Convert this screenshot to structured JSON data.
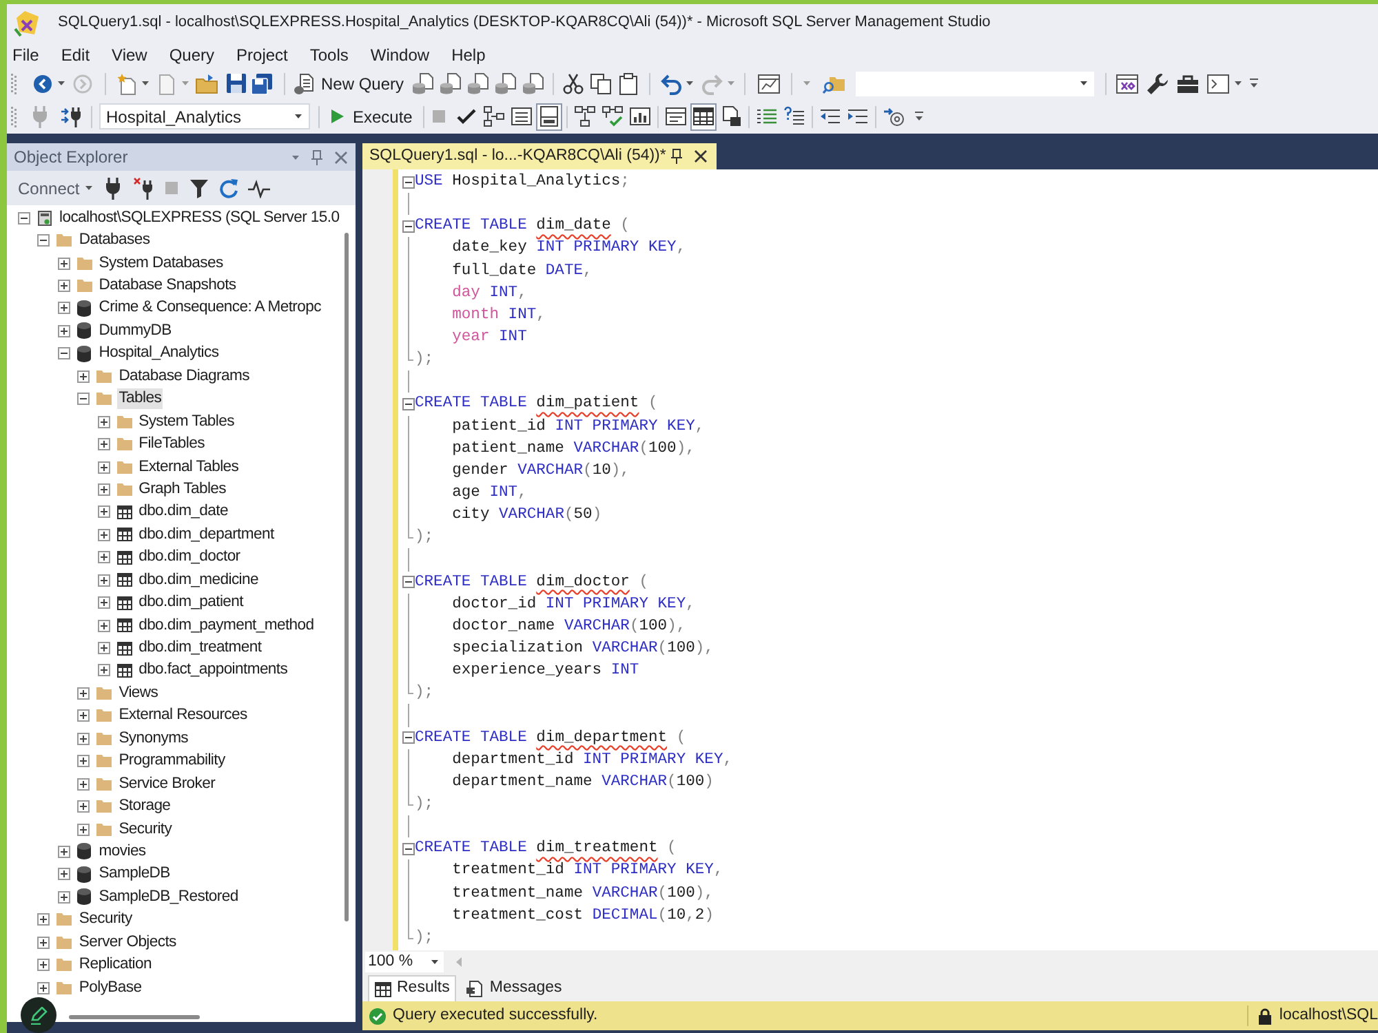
{
  "window": {
    "title": "SQLQuery1.sql - localhost\\SQLEXPRESS.Hospital_Analytics (DESKTOP-KQAR8CQ\\Ali (54))* - Microsoft SQL Server Management Studio"
  },
  "menu": [
    "File",
    "Edit",
    "View",
    "Query",
    "Project",
    "Tools",
    "Window",
    "Help"
  ],
  "standard_toolbar": {
    "new_query": "New Query"
  },
  "query_toolbar": {
    "database": "Hospital_Analytics",
    "execute": "Execute",
    "buttons": [
      {
        "selected": false
      },
      {
        "selected": false
      },
      {
        "selected": false
      },
      {
        "selected": false
      },
      {
        "selected": true
      },
      {
        "selected": false
      },
      {
        "selected": false
      },
      {
        "selected": false
      },
      {
        "selected": false
      },
      {
        "selected": true
      },
      {
        "selected": false
      },
      {
        "selected": false
      },
      {
        "selected": false
      },
      {
        "selected": false
      },
      {
        "selected": false
      },
      {
        "selected": false
      }
    ]
  },
  "object_explorer": {
    "title": "Object Explorer",
    "connect": "Connect",
    "tree": [
      {
        "label": "localhost\\SQLEXPRESS (SQL Server 15.0",
        "kind": "server",
        "expanded": true,
        "selected": false,
        "children": [
          {
            "label": "Databases",
            "kind": "folder",
            "expanded": true,
            "selected": false,
            "children": [
              {
                "label": "System Databases",
                "kind": "folder",
                "expanded": false,
                "selected": false
              },
              {
                "label": "Database Snapshots",
                "kind": "folder",
                "expanded": false,
                "selected": false
              },
              {
                "label": "Crime & Consequence: A Metropc",
                "kind": "database",
                "expanded": false,
                "selected": false
              },
              {
                "label": "DummyDB",
                "kind": "database",
                "expanded": false,
                "selected": false
              },
              {
                "label": "Hospital_Analytics",
                "kind": "database",
                "expanded": true,
                "selected": false,
                "children": [
                  {
                    "label": "Database Diagrams",
                    "kind": "folder",
                    "expanded": false,
                    "selected": false
                  },
                  {
                    "label": "Tables",
                    "kind": "folder",
                    "expanded": true,
                    "selected": true,
                    "children": [
                      {
                        "label": "System Tables",
                        "kind": "folder",
                        "expanded": false,
                        "selected": false
                      },
                      {
                        "label": "FileTables",
                        "kind": "folder",
                        "expanded": false,
                        "selected": false
                      },
                      {
                        "label": "External Tables",
                        "kind": "folder",
                        "expanded": false,
                        "selected": false
                      },
                      {
                        "label": "Graph Tables",
                        "kind": "folder",
                        "expanded": false,
                        "selected": false
                      },
                      {
                        "label": "dbo.dim_date",
                        "kind": "table",
                        "expanded": false,
                        "selected": false
                      },
                      {
                        "label": "dbo.dim_department",
                        "kind": "table",
                        "expanded": false,
                        "selected": false
                      },
                      {
                        "label": "dbo.dim_doctor",
                        "kind": "table",
                        "expanded": false,
                        "selected": false
                      },
                      {
                        "label": "dbo.dim_medicine",
                        "kind": "table",
                        "expanded": false,
                        "selected": false
                      },
                      {
                        "label": "dbo.dim_patient",
                        "kind": "table",
                        "expanded": false,
                        "selected": false
                      },
                      {
                        "label": "dbo.dim_payment_method",
                        "kind": "table",
                        "expanded": false,
                        "selected": false
                      },
                      {
                        "label": "dbo.dim_treatment",
                        "kind": "table",
                        "expanded": false,
                        "selected": false
                      },
                      {
                        "label": "dbo.fact_appointments",
                        "kind": "table",
                        "expanded": false,
                        "selected": false
                      }
                    ]
                  },
                  {
                    "label": "Views",
                    "kind": "folder",
                    "expanded": false,
                    "selected": false
                  },
                  {
                    "label": "External Resources",
                    "kind": "folder",
                    "expanded": false,
                    "selected": false
                  },
                  {
                    "label": "Synonyms",
                    "kind": "folder",
                    "expanded": false,
                    "selected": false
                  },
                  {
                    "label": "Programmability",
                    "kind": "folder",
                    "expanded": false,
                    "selected": false
                  },
                  {
                    "label": "Service Broker",
                    "kind": "folder",
                    "expanded": false,
                    "selected": false
                  },
                  {
                    "label": "Storage",
                    "kind": "folder",
                    "expanded": false,
                    "selected": false
                  },
                  {
                    "label": "Security",
                    "kind": "folder",
                    "expanded": false,
                    "selected": false
                  }
                ]
              },
              {
                "label": "movies",
                "kind": "database",
                "expanded": false,
                "selected": false
              },
              {
                "label": "SampleDB",
                "kind": "database",
                "expanded": false,
                "selected": false
              },
              {
                "label": "SampleDB_Restored",
                "kind": "database",
                "expanded": false,
                "selected": false
              }
            ]
          },
          {
            "label": "Security",
            "kind": "folder",
            "expanded": false,
            "selected": false
          },
          {
            "label": "Server Objects",
            "kind": "folder",
            "expanded": false,
            "selected": false
          },
          {
            "label": "Replication",
            "kind": "folder",
            "expanded": false,
            "selected": false
          },
          {
            "label": "PolyBase",
            "kind": "folder",
            "expanded": false,
            "selected": false
          }
        ]
      }
    ]
  },
  "editor": {
    "tab_title": "SQLQuery1.sql - lo...-KQAR8CQ\\Ali (54))*",
    "statements": [
      {
        "lines": [
          {
            "tokens": [
              {
                "text": "USE",
                "kind": "keyword"
              },
              {
                "text": " Hospital_Analytics",
                "kind": "plain"
              },
              {
                "text": ";",
                "kind": "punct"
              }
            ]
          }
        ]
      },
      {
        "lines": [
          {
            "tokens": [
              {
                "text": "CREATE TABLE ",
                "kind": "keyword"
              },
              {
                "text": "dim_date",
                "kind": "flagged"
              },
              {
                "text": " (",
                "kind": "punct"
              }
            ],
            "children": [
              {
                "tokens": [
                  {
                    "text": "date_key ",
                    "kind": "plain"
                  },
                  {
                    "text": "INT PRIMARY KEY",
                    "kind": "keyword"
                  },
                  {
                    "text": ",",
                    "kind": "punct"
                  }
                ]
              },
              {
                "tokens": [
                  {
                    "text": "full_date ",
                    "kind": "plain"
                  },
                  {
                    "text": "DATE",
                    "kind": "keyword"
                  },
                  {
                    "text": ",",
                    "kind": "punct"
                  }
                ]
              },
              {
                "tokens": [
                  {
                    "text": "day",
                    "kind": "builtin"
                  },
                  {
                    "text": " INT",
                    "kind": "keyword"
                  },
                  {
                    "text": ",",
                    "kind": "punct"
                  }
                ]
              },
              {
                "tokens": [
                  {
                    "text": "month",
                    "kind": "builtin"
                  },
                  {
                    "text": " INT",
                    "kind": "keyword"
                  },
                  {
                    "text": ",",
                    "kind": "punct"
                  }
                ]
              },
              {
                "tokens": [
                  {
                    "text": "year",
                    "kind": "builtin"
                  },
                  {
                    "text": " INT",
                    "kind": "keyword"
                  }
                ]
              }
            ]
          },
          {
            "tokens": [
              {
                "text": ");",
                "kind": "punct"
              }
            ]
          }
        ]
      },
      {
        "lines": [
          {
            "tokens": [
              {
                "text": "CREATE TABLE ",
                "kind": "keyword"
              },
              {
                "text": "dim_patient",
                "kind": "flagged"
              },
              {
                "text": " (",
                "kind": "punct"
              }
            ],
            "children": [
              {
                "tokens": [
                  {
                    "text": "patient_id ",
                    "kind": "plain"
                  },
                  {
                    "text": "INT PRIMARY KEY",
                    "kind": "keyword"
                  },
                  {
                    "text": ",",
                    "kind": "punct"
                  }
                ]
              },
              {
                "tokens": [
                  {
                    "text": "patient_name ",
                    "kind": "plain"
                  },
                  {
                    "text": "VARCHAR",
                    "kind": "keyword"
                  },
                  {
                    "text": "(",
                    "kind": "punct"
                  },
                  {
                    "text": "100",
                    "kind": "plain"
                  },
                  {
                    "text": "),",
                    "kind": "punct"
                  }
                ]
              },
              {
                "tokens": [
                  {
                    "text": "gender ",
                    "kind": "plain"
                  },
                  {
                    "text": "VARCHAR",
                    "kind": "keyword"
                  },
                  {
                    "text": "(",
                    "kind": "punct"
                  },
                  {
                    "text": "10",
                    "kind": "plain"
                  },
                  {
                    "text": "),",
                    "kind": "punct"
                  }
                ]
              },
              {
                "tokens": [
                  {
                    "text": "age ",
                    "kind": "plain"
                  },
                  {
                    "text": "INT",
                    "kind": "keyword"
                  },
                  {
                    "text": ",",
                    "kind": "punct"
                  }
                ]
              },
              {
                "tokens": [
                  {
                    "text": "city ",
                    "kind": "plain"
                  },
                  {
                    "text": "VARCHAR",
                    "kind": "keyword"
                  },
                  {
                    "text": "(",
                    "kind": "punct"
                  },
                  {
                    "text": "50",
                    "kind": "plain"
                  },
                  {
                    "text": ")",
                    "kind": "punct"
                  }
                ]
              }
            ]
          },
          {
            "tokens": [
              {
                "text": ");",
                "kind": "punct"
              }
            ]
          }
        ]
      },
      {
        "lines": [
          {
            "tokens": [
              {
                "text": "CREATE TABLE ",
                "kind": "keyword"
              },
              {
                "text": "dim_doctor",
                "kind": "flagged"
              },
              {
                "text": " (",
                "kind": "punct"
              }
            ],
            "children": [
              {
                "tokens": [
                  {
                    "text": "doctor_id ",
                    "kind": "plain"
                  },
                  {
                    "text": "INT PRIMARY KEY",
                    "kind": "keyword"
                  },
                  {
                    "text": ",",
                    "kind": "punct"
                  }
                ]
              },
              {
                "tokens": [
                  {
                    "text": "doctor_name ",
                    "kind": "plain"
                  },
                  {
                    "text": "VARCHAR",
                    "kind": "keyword"
                  },
                  {
                    "text": "(",
                    "kind": "punct"
                  },
                  {
                    "text": "100",
                    "kind": "plain"
                  },
                  {
                    "text": "),",
                    "kind": "punct"
                  }
                ]
              },
              {
                "tokens": [
                  {
                    "text": "specialization ",
                    "kind": "plain"
                  },
                  {
                    "text": "VARCHAR",
                    "kind": "keyword"
                  },
                  {
                    "text": "(",
                    "kind": "punct"
                  },
                  {
                    "text": "100",
                    "kind": "plain"
                  },
                  {
                    "text": "),",
                    "kind": "punct"
                  }
                ]
              },
              {
                "tokens": [
                  {
                    "text": "experience_years ",
                    "kind": "plain"
                  },
                  {
                    "text": "INT",
                    "kind": "keyword"
                  }
                ]
              }
            ]
          },
          {
            "tokens": [
              {
                "text": ");",
                "kind": "punct"
              }
            ]
          }
        ]
      },
      {
        "lines": [
          {
            "tokens": [
              {
                "text": "CREATE TABLE ",
                "kind": "keyword"
              },
              {
                "text": "dim_department",
                "kind": "flagged"
              },
              {
                "text": " (",
                "kind": "punct"
              }
            ],
            "children": [
              {
                "tokens": [
                  {
                    "text": "department_id ",
                    "kind": "plain"
                  },
                  {
                    "text": "INT PRIMARY KEY",
                    "kind": "keyword"
                  },
                  {
                    "text": ",",
                    "kind": "punct"
                  }
                ]
              },
              {
                "tokens": [
                  {
                    "text": "department_name ",
                    "kind": "plain"
                  },
                  {
                    "text": "VARCHAR",
                    "kind": "keyword"
                  },
                  {
                    "text": "(",
                    "kind": "punct"
                  },
                  {
                    "text": "100",
                    "kind": "plain"
                  },
                  {
                    "text": ")",
                    "kind": "punct"
                  }
                ]
              }
            ]
          },
          {
            "tokens": [
              {
                "text": ");",
                "kind": "punct"
              }
            ]
          }
        ]
      },
      {
        "lines": [
          {
            "tokens": [
              {
                "text": "CREATE TABLE ",
                "kind": "keyword"
              },
              {
                "text": "dim_treatment",
                "kind": "flagged"
              },
              {
                "text": " (",
                "kind": "punct"
              }
            ],
            "children": [
              {
                "tokens": [
                  {
                    "text": "treatment_id ",
                    "kind": "plain"
                  },
                  {
                    "text": "INT PRIMARY KEY",
                    "kind": "keyword"
                  },
                  {
                    "text": ",",
                    "kind": "punct"
                  }
                ]
              },
              {
                "tokens": [
                  {
                    "text": "treatment_name ",
                    "kind": "plain"
                  },
                  {
                    "text": "VARCHAR",
                    "kind": "keyword"
                  },
                  {
                    "text": "(",
                    "kind": "punct"
                  },
                  {
                    "text": "100",
                    "kind": "plain"
                  },
                  {
                    "text": "),",
                    "kind": "punct"
                  }
                ]
              },
              {
                "tokens": [
                  {
                    "text": "treatment_cost ",
                    "kind": "plain"
                  },
                  {
                    "text": "DECIMAL",
                    "kind": "keyword"
                  },
                  {
                    "text": "(",
                    "kind": "punct"
                  },
                  {
                    "text": "10",
                    "kind": "plain"
                  },
                  {
                    "text": ",",
                    "kind": "punct"
                  },
                  {
                    "text": "2",
                    "kind": "plain"
                  },
                  {
                    "text": ")",
                    "kind": "punct"
                  }
                ]
              }
            ]
          },
          {
            "tokens": [
              {
                "text": ");",
                "kind": "punct"
              }
            ]
          }
        ]
      }
    ],
    "zoom": "100 %"
  },
  "result_tabs": [
    {
      "label": "Results",
      "selected": true
    },
    {
      "label": "Messages",
      "selected": false
    }
  ],
  "status_bar": {
    "message": "Query executed successfully.",
    "server": "localhost\\SQL"
  }
}
